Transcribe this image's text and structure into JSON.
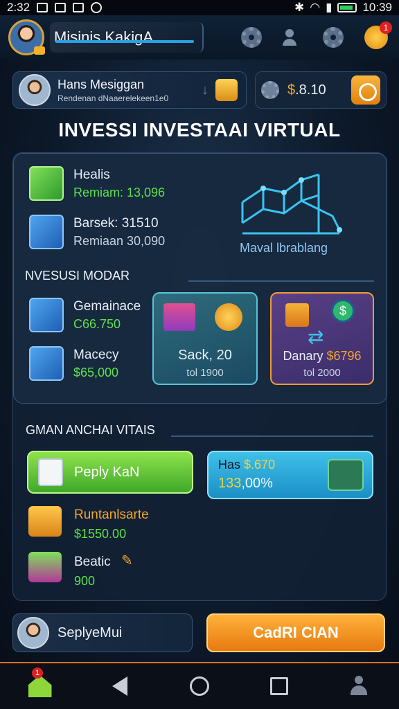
{
  "status_bar": {
    "time_left": "2:32",
    "time_right": "10:39"
  },
  "top_bar": {
    "title": "Misinis KakigA",
    "notification_count": "1"
  },
  "profile": {
    "name": "Hans Mesiggan",
    "subtitle": "Rendenan dNaaerelekeen1e0"
  },
  "balance": {
    "currency": "$",
    "value": ".8.10"
  },
  "section_title": "INVESSI INVESTAAI VIRTUAL",
  "assets": [
    {
      "name": "Healis",
      "value": "Remiam: 13,096"
    },
    {
      "name": "Barsek: 31510",
      "value": "Remiaan 30,090"
    }
  ],
  "chart_label": "Maval lbrablang",
  "modal_section": {
    "title": "NVESUSI MODAR",
    "items": [
      {
        "name": "Gemainace",
        "value": "C66.750"
      },
      {
        "name": "Macecy",
        "value": "$65,000"
      }
    ],
    "cards": [
      {
        "title": "Sack, 20",
        "subtitle": "tol 1900"
      },
      {
        "title_prefix": "Danary",
        "title_value": "$6796",
        "subtitle": "tol 2000"
      }
    ]
  },
  "gman_section": {
    "title": "GMAN ANCHAI VITAIS",
    "green_button": "Peply KaN",
    "cyan_card": {
      "label": "Has",
      "label_value": "$.670",
      "value_prefix": "133",
      "value_suffix": ",00%"
    },
    "list": [
      {
        "name": "Runtanlsarte",
        "value": "$1550.00"
      },
      {
        "name": "Beatic",
        "value": "900"
      }
    ]
  },
  "bottom": {
    "profile_name": "SeplyeMui",
    "cta": "CadRI CIAN"
  },
  "navbar": {
    "badge": "1"
  },
  "colors": {
    "accent_green": "#5ee14a",
    "accent_orange": "#f3a62a",
    "accent_cyan": "#3fc0e8"
  }
}
